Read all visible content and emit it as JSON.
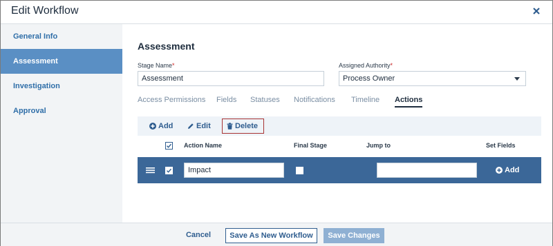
{
  "dialog": {
    "title": "Edit Workflow",
    "close_icon": "close-icon"
  },
  "sidebar": {
    "items": [
      {
        "label": "General Info",
        "active": false
      },
      {
        "label": "Assessment",
        "active": true
      },
      {
        "label": "Investigation",
        "active": false
      },
      {
        "label": "Approval",
        "active": false
      }
    ]
  },
  "main": {
    "section_title": "Assessment",
    "stage_name": {
      "label": "Stage Name",
      "required_mark": "*",
      "value": "Assessment"
    },
    "assigned_authority": {
      "label": "Assigned Authority",
      "required_mark": "*",
      "value": "Process Owner"
    },
    "tabs": [
      {
        "label": "Access Permissions",
        "active": false
      },
      {
        "label": "Fields",
        "active": false
      },
      {
        "label": "Statuses",
        "active": false
      },
      {
        "label": "Notifications",
        "active": false
      },
      {
        "label": "Timeline",
        "active": false
      },
      {
        "label": "Actions",
        "active": true
      }
    ],
    "toolbar": {
      "add_label": "Add",
      "edit_label": "Edit",
      "delete_label": "Delete"
    },
    "grid": {
      "columns": [
        "Action Name",
        "Final Stage",
        "Jump to",
        "Set Fields"
      ],
      "header_checked": true,
      "rows": [
        {
          "checked": true,
          "action_name": "Impact",
          "final_stage": false,
          "jump_to": "",
          "set_fields_label": "Add"
        }
      ]
    }
  },
  "footer": {
    "cancel_label": "Cancel",
    "save_new_label": "Save As New Workflow",
    "save_changes_label": "Save Changes"
  },
  "colors": {
    "accent": "#3b6798",
    "active_sidebar": "#5a8fc4",
    "delete_outline": "#a83232",
    "disabled_button": "#8fb0d3"
  }
}
